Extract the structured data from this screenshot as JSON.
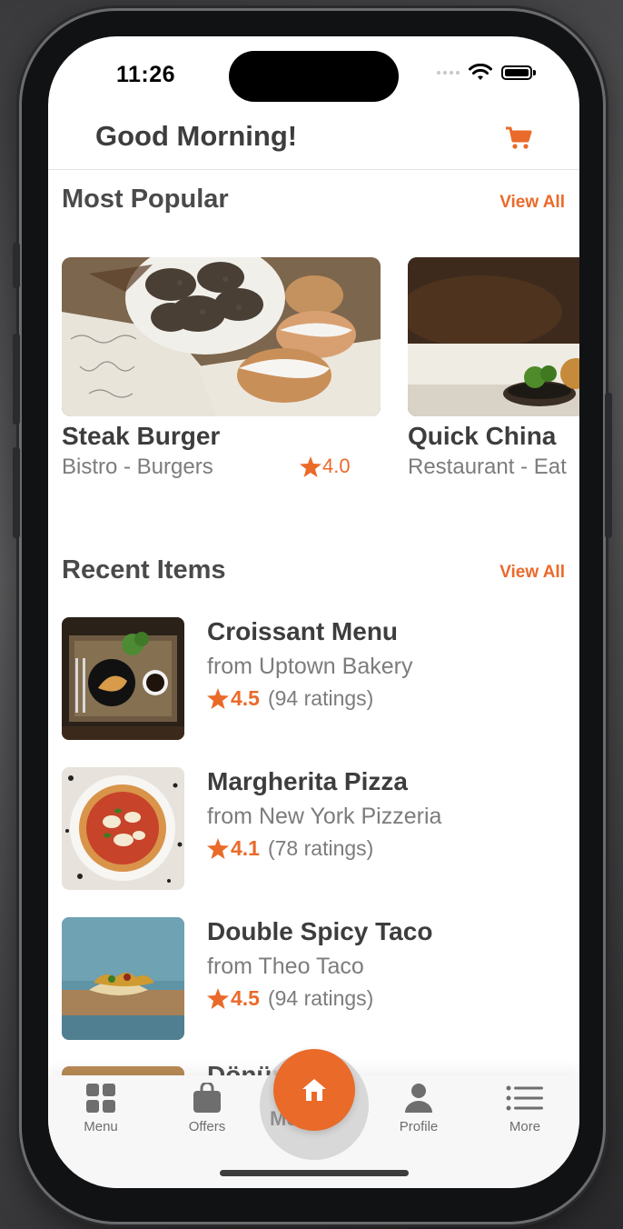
{
  "status_bar": {
    "time": "11:26"
  },
  "header": {
    "greeting": "Good Morning!",
    "cart_icon": "cart-icon"
  },
  "most_popular": {
    "title": "Most Popular",
    "view_all": "View All",
    "cards": [
      {
        "name": "Steak Burger",
        "subtitle": "Bistro - Burgers",
        "rating": "4.0"
      },
      {
        "name": "Quick China",
        "subtitle": "Restaurant - Eat",
        "rating": ""
      }
    ]
  },
  "recent_items": {
    "title": "Recent Items",
    "view_all": "View All",
    "items": [
      {
        "name": "Croissant Menu",
        "from": "from Uptown Bakery",
        "rating": "4.5",
        "count": "(94 ratings)"
      },
      {
        "name": "Margherita Pizza",
        "from": "from New York Pizzeria",
        "rating": "4.1",
        "count": "(78 ratings)"
      },
      {
        "name": "Double Spicy Taco",
        "from": "from Theo Taco",
        "rating": "4.5",
        "count": "(94 ratings)"
      }
    ],
    "partial_item": {
      "name": "Dönür A"
    }
  },
  "tab_bar": {
    "tabs": [
      {
        "label": "Menu",
        "icon": "grid-icon"
      },
      {
        "label": "Offers",
        "icon": "shopping-bag-icon"
      },
      {
        "label": "Profile",
        "icon": "person-icon"
      },
      {
        "label": "More",
        "icon": "list-icon"
      }
    ],
    "home_icon": "home-icon",
    "ghost_text": "Mez"
  },
  "colors": {
    "accent": "#ea6a2a",
    "text_dark": "#3d3d3d",
    "text_muted": "#7c7c7c"
  }
}
